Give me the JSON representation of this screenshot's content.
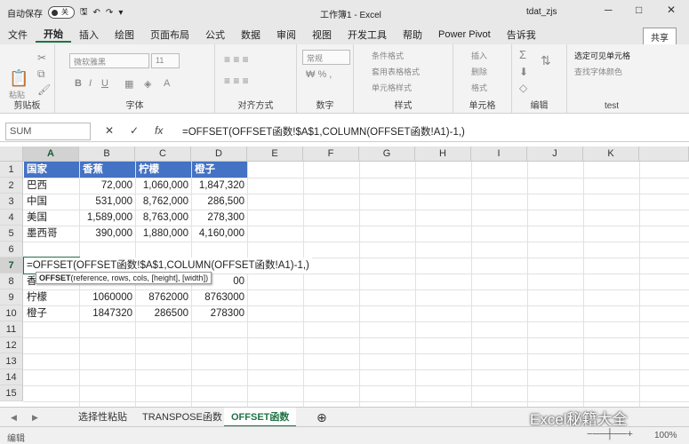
{
  "titlebar": {
    "autosave_label": "自动保存",
    "autosave_state": "关",
    "title": "工作簿1 - Excel",
    "user": "tdat_zjs",
    "minimize": "─",
    "restore": "□",
    "close": "✕"
  },
  "menu": {
    "items": [
      "文件",
      "开始",
      "插入",
      "绘图",
      "页面布局",
      "公式",
      "数据",
      "审阅",
      "视图",
      "开发工具",
      "帮助",
      "Power Pivot",
      "告诉我"
    ],
    "share": "共享"
  },
  "ribbon": {
    "groups": [
      "剪贴板",
      "字体",
      "对齐方式",
      "数字",
      "样式",
      "单元格",
      "编辑",
      "test"
    ],
    "paste": "粘贴",
    "font_name": "微软雅黑",
    "font_size": "11",
    "number_format": "常规",
    "conditional": "条件格式",
    "table_format": "套用表格格式",
    "cell_style": "单元格样式",
    "insert": "插入",
    "delete": "删除",
    "format": "格式",
    "select_visible": "选定可见单元格",
    "mark_color": "查找字体颜色"
  },
  "formula_bar": {
    "name_box": "SUM",
    "cancel": "✕",
    "enter": "✓",
    "fx": "fx",
    "formula": "=OFFSET(OFFSET函数!$A$1,COLUMN(OFFSET函数!A1)-1,)"
  },
  "columns": [
    "A",
    "B",
    "C",
    "D",
    "E",
    "F",
    "G",
    "H",
    "I",
    "J",
    "K"
  ],
  "rows": [
    "1",
    "2",
    "3",
    "4",
    "5",
    "6",
    "7",
    "8",
    "9",
    "10",
    "11",
    "12",
    "13",
    "14",
    "15"
  ],
  "table": {
    "header": [
      "国家",
      "香蕉",
      "柠檬",
      "橙子"
    ],
    "data": [
      [
        "巴西",
        "72,000",
        "1,060,000",
        "1,847,320"
      ],
      [
        "中国",
        "531,000",
        "8,762,000",
        "286,500"
      ],
      [
        "美国",
        "1,589,000",
        "8,763,000",
        "278,300"
      ],
      [
        "墨西哥",
        "390,000",
        "1,880,000",
        "4,160,000"
      ]
    ]
  },
  "editing_cell": "=OFFSET(OFFSET函数!$A$1,COLUMN(OFFSET函数!A1)-1,)",
  "tooltip": {
    "fn": "OFFSET",
    "args": "(reference, rows, cols, [height], [width])"
  },
  "row8": {
    "a": "香",
    "d": "00"
  },
  "row9": [
    "柠檬",
    "1060000",
    "8762000",
    "8763000"
  ],
  "row10": [
    "橙子",
    "1847320",
    "286500",
    "278300"
  ],
  "sheets": [
    "选择性粘贴",
    "TRANSPOSE函数",
    "OFFSET函数"
  ],
  "status": {
    "mode": "编辑",
    "zoom": "100%"
  },
  "watermark": "Excel秘籍大全"
}
